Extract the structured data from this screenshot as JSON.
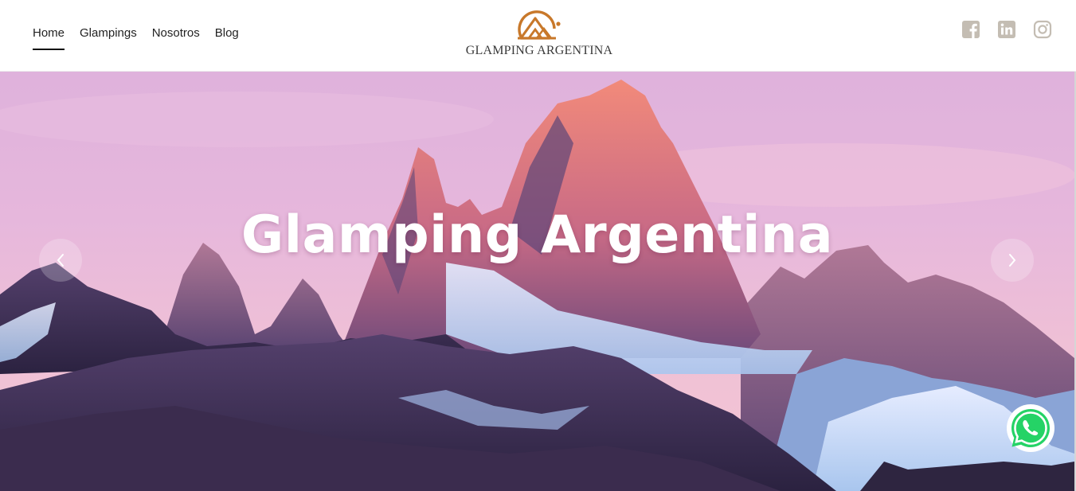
{
  "nav": {
    "items": [
      {
        "label": "Home",
        "active": true
      },
      {
        "label": "Glampings",
        "active": false
      },
      {
        "label": "Nosotros",
        "active": false
      },
      {
        "label": "Blog",
        "active": false
      }
    ]
  },
  "logo": {
    "text": "GLAMPING ARGENTINA",
    "icon": "mountain-tent-icon",
    "color": "#c8782a"
  },
  "social": {
    "icons": [
      "facebook-icon",
      "linkedin-icon",
      "instagram-icon"
    ],
    "color": "#c4bdb3"
  },
  "hero": {
    "title": "Glamping Argentina",
    "prev_icon": "chevron-left-icon",
    "next_icon": "chevron-right-icon"
  },
  "whatsapp": {
    "icon": "whatsapp-icon",
    "color": "#25d366"
  }
}
